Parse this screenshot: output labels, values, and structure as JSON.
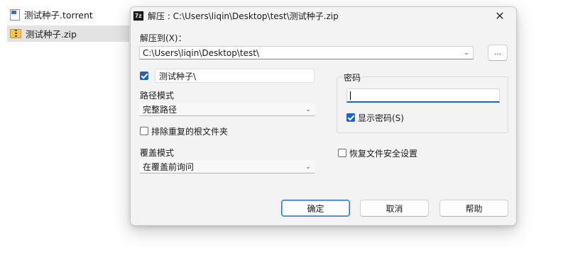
{
  "explorer": {
    "files": [
      {
        "name": "测试种子.torrent",
        "icon": "torrent-file-icon"
      },
      {
        "name": "测试种子.zip",
        "icon": "zip-folder-icon"
      }
    ]
  },
  "dialog": {
    "title": "解压 : C:\\Users\\liqin\\Desktop\\test\\测试种子.zip",
    "close_glyph": "✕",
    "app_icon_text": "7z",
    "extract_to": {
      "label": "解压到(X)：",
      "value": "C:\\Users\\liqin\\Desktop\\test\\",
      "browse_label": "..."
    },
    "subfolder": {
      "checked": true,
      "value": "测试种子\\"
    },
    "path_mode": {
      "label": "路径模式",
      "value": "完整路径"
    },
    "eliminate_root": {
      "checked": false,
      "label": "排除重复的根文件夹"
    },
    "overwrite_mode": {
      "label": "覆盖模式",
      "value": "在覆盖前询问"
    },
    "password": {
      "group_label": "密码",
      "value": "",
      "show_password": {
        "checked": true,
        "label": "显示密码(S)"
      }
    },
    "restore_security": {
      "checked": false,
      "label": "恢复文件安全设置"
    },
    "buttons": {
      "ok": "确定",
      "cancel": "取消",
      "help": "帮助"
    }
  },
  "colors": {
    "accent": "#1f63c7",
    "dialog_bg": "#f3f3f3"
  }
}
